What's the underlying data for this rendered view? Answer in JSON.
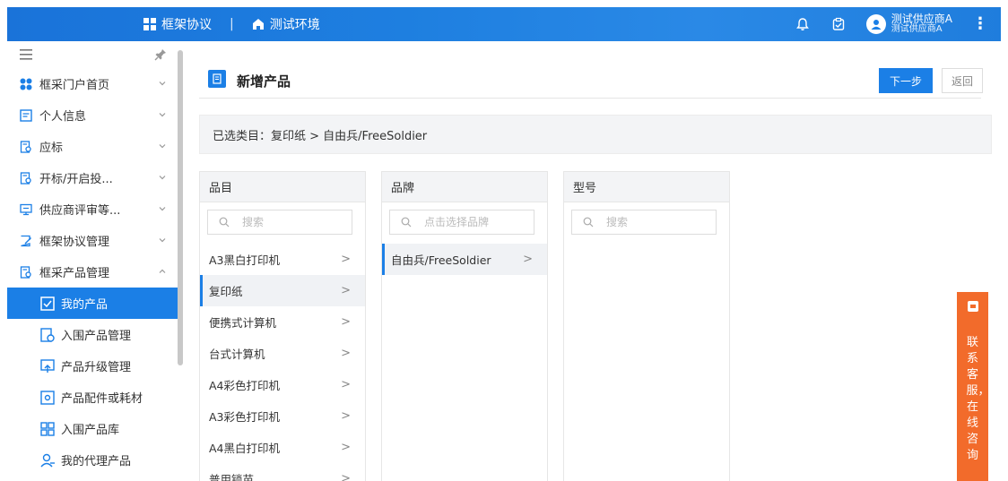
{
  "header": {
    "app_title": "框架协议",
    "separator": "|",
    "env_label": "测试环境",
    "user_name": "测试供应商A",
    "user_org": "测试供应商A",
    "accent": "#1b7fe6"
  },
  "sidebar": {
    "items": [
      {
        "label": "框采门户首页"
      },
      {
        "label": "个人信息"
      },
      {
        "label": "应标"
      },
      {
        "label": "开标/开启投..."
      },
      {
        "label": "供应商评审等..."
      },
      {
        "label": "框架协议管理"
      },
      {
        "label": "框采产品管理"
      }
    ],
    "subitems": [
      {
        "label": "我的产品"
      },
      {
        "label": "入围产品管理"
      },
      {
        "label": "产品升级管理"
      },
      {
        "label": "产品配件或耗材"
      },
      {
        "label": "入围产品库"
      },
      {
        "label": "我的代理产品"
      }
    ]
  },
  "page": {
    "title": "新增产品",
    "next_label": "下一步",
    "back_label": "返回",
    "selected_text": "已选类目：复印纸 > 自由兵/FreeSoldier"
  },
  "panels": {
    "category": {
      "header": "品目",
      "search_placeholder": "搜索",
      "items": [
        {
          "label": "A3黑白打印机"
        },
        {
          "label": "复印纸"
        },
        {
          "label": "便携式计算机"
        },
        {
          "label": "台式计算机"
        },
        {
          "label": "A4彩色打印机"
        },
        {
          "label": "A3彩色打印机"
        },
        {
          "label": "A4黑白打印机"
        },
        {
          "label": "普用锁苗"
        }
      ],
      "arrow": ">"
    },
    "brand": {
      "header": "品牌",
      "search_placeholder": "点击选择品牌",
      "items": [
        {
          "label": "自由兵/FreeSoldier"
        }
      ],
      "arrow": ">"
    },
    "model": {
      "header": "型号",
      "search_placeholder": "搜索"
    }
  },
  "service": {
    "label": "联系客服，在线咨询",
    "color": "#f26b2b"
  }
}
